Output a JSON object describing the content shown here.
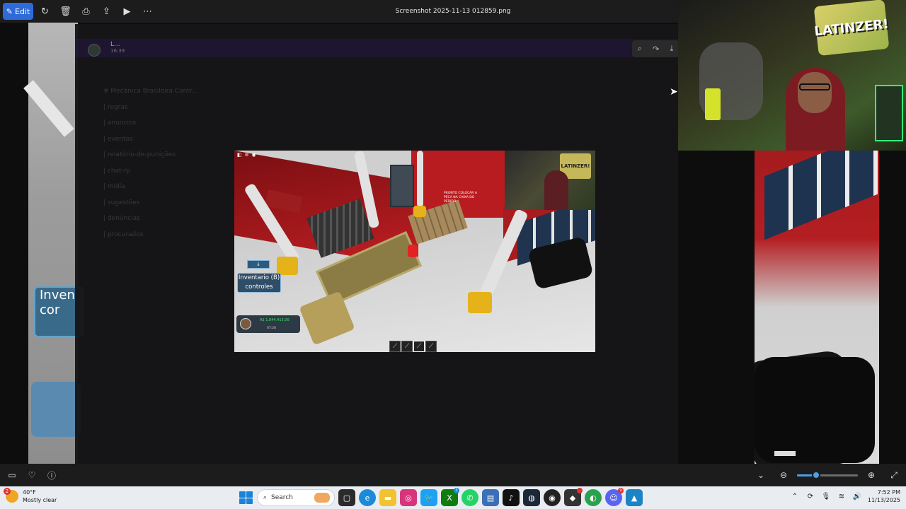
{
  "viewer": {
    "edit_label": "Edit",
    "file_title": "Screenshot 2025-11-13 012859.png"
  },
  "discord": {
    "user": "L...",
    "time": "16:39",
    "channels": [
      "# Mecânica Brasileira Contr...",
      "| regras",
      "| anúncios",
      "| eventos",
      "| relatório-de-punições",
      "| chat-rp",
      "| mídia",
      "| sugestões",
      "| denúncias",
      "| procurados"
    ]
  },
  "game": {
    "inventory_label_1": "Inventario (B)",
    "inventory_label_2": "controles",
    "money": "R$ 1.844.415,00",
    "time": "07:26",
    "sign_text": "PRONTO COLOCAR A PECA NA CAIXA DO PEDIDO",
    "webcam_sign": "LATINZER!",
    "hud_arrow": "↓"
  },
  "background": {
    "inv_text_1": "Inven",
    "inv_text_2": "cor"
  },
  "stream": {
    "sign_text": "LATINZER!"
  },
  "bottom": {
    "zoom_fraction": 0.31
  },
  "taskbar": {
    "temperature": "40°F",
    "condition": "Mostly clear",
    "weather_badge": "2",
    "search_label": "Search",
    "time": "7:52 PM",
    "date": "11/13/2025"
  },
  "colors": {
    "accent": "#2e6bd9",
    "zoom": "#4ba0e8",
    "taskbar_bg": "#e9edf1"
  }
}
